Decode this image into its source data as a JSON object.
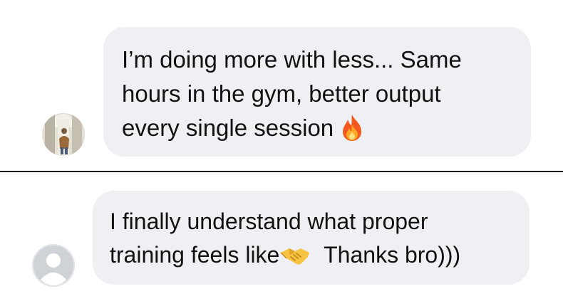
{
  "conversation": {
    "messages": [
      {
        "lines": [
          "I’m doing more with less... Same",
          "hours in the gym, better output",
          "every single session"
        ],
        "emoji": "fire-emoji",
        "avatar": "user-photo-avatar"
      },
      {
        "lines": [
          "I finally understand what proper",
          "training feels like",
          "Thanks bro)))"
        ],
        "emoji": "handshake-emoji",
        "avatar": "default-avatar"
      }
    ]
  },
  "colors": {
    "bubble_background": "#eef0f3",
    "text": "#111111",
    "divider": "#111111",
    "background": "#ffffff"
  }
}
